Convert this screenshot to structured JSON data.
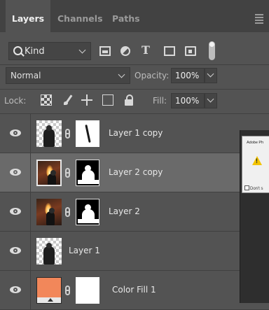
{
  "tabs": [
    "Layers",
    "Channels",
    "Paths"
  ],
  "filter": {
    "kind_label": "Kind"
  },
  "blend": {
    "mode": "Normal",
    "opacity_label": "Opacity:",
    "opacity_value": "100%"
  },
  "lock": {
    "label": "Lock:",
    "fill_label": "Fill:",
    "fill_value": "100%"
  },
  "layers": [
    {
      "name": "Layer 1 copy",
      "selected": false
    },
    {
      "name": "Layer 2 copy",
      "selected": true
    },
    {
      "name": "Layer 2",
      "selected": false
    },
    {
      "name": "Layer 1",
      "selected": false
    },
    {
      "name": "Color Fill 1",
      "selected": false,
      "fill_color": "#f2875a"
    }
  ],
  "dialog": {
    "title": "Adobe Ph",
    "dont_show": "Don't s"
  },
  "colors": {
    "panel": "#535353",
    "tabbar": "#424242",
    "selected_row": "#6a6a6a",
    "warning": "#f3c400"
  }
}
